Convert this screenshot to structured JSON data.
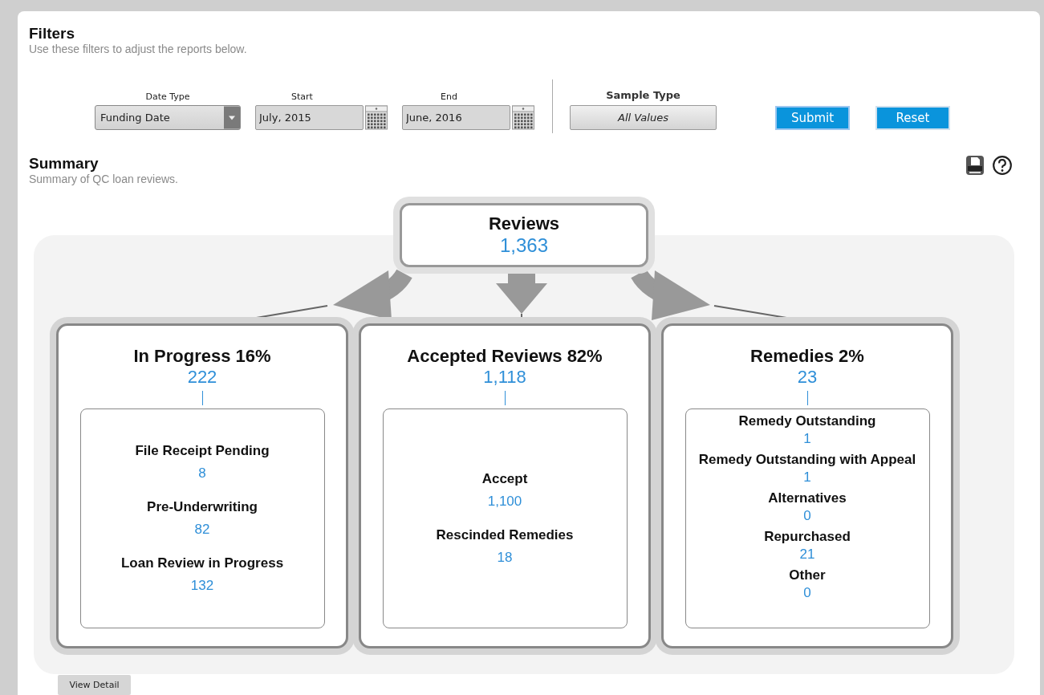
{
  "filters": {
    "title": "Filters",
    "subtitle": "Use these filters to adjust the reports below.",
    "date_type": {
      "label": "Date Type",
      "value": "Funding Date"
    },
    "start": {
      "label": "Start",
      "value": "July, 2015"
    },
    "end": {
      "label": "End",
      "value": "June, 2016"
    },
    "sample_type": {
      "label": "Sample Type",
      "value": "All Values"
    },
    "buttons": [
      "Submit",
      "Reset"
    ]
  },
  "summary": {
    "title": "Summary",
    "subtitle": "Summary of QC loan reviews.",
    "total": {
      "label": "Reviews",
      "value": "1,363"
    },
    "groups": [
      {
        "title": "In Progress 16%",
        "value": "222",
        "items": [
          {
            "label": "File Receipt Pending",
            "value": "8"
          },
          {
            "label": "Pre-Underwriting",
            "value": "82"
          },
          {
            "label": "Loan Review in Progress",
            "value": "132"
          }
        ]
      },
      {
        "title": "Accepted Reviews 82%",
        "value": "1,118",
        "items": [
          {
            "label": "Accept",
            "value": "1,100"
          },
          {
            "label": "Rescinded Remedies",
            "value": "18"
          }
        ]
      },
      {
        "title": "Remedies 2%",
        "value": "23",
        "items": [
          {
            "label": "Remedy Outstanding",
            "value": "1"
          },
          {
            "label": "Remedy Outstanding with Appeal",
            "value": "1"
          },
          {
            "label": "Alternatives",
            "value": "0"
          },
          {
            "label": "Repurchased",
            "value": "21"
          },
          {
            "label": "Other",
            "value": "0"
          }
        ]
      }
    ]
  },
  "view_detail": "View Detail"
}
